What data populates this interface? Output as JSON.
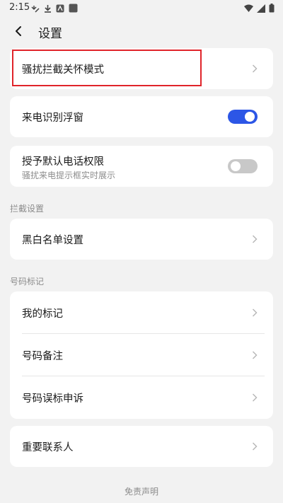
{
  "status_bar": {
    "time": "2:15",
    "icons": [
      "missed-call-icon",
      "download-icon",
      "app-a-icon",
      "app-square-icon",
      "wifi-icon",
      "signal-icon",
      "battery-icon"
    ]
  },
  "header": {
    "title": "设置"
  },
  "groups": {
    "harass_mode": {
      "label": "骚扰拦截关怀模式"
    },
    "float_window": {
      "label": "来电识别浮窗",
      "toggle_on": true
    },
    "default_phone": {
      "label": "授予默认电话权限",
      "subtitle": "骚扰来电提示框实时展示",
      "toggle_on": false
    },
    "block_section_title": "拦截设置",
    "blocklist": {
      "label": "黑白名单设置"
    },
    "mark_section_title": "号码标记",
    "my_marks": {
      "label": "我的标记"
    },
    "number_notes": {
      "label": "号码备注"
    },
    "mis_mark_appeal": {
      "label": "号码误标申诉"
    },
    "important_contacts": {
      "label": "重要联系人"
    }
  },
  "footer": {
    "disclaimer": "免责声明"
  },
  "colors": {
    "accent": "#2c56e6",
    "highlight": "#e0242a",
    "background": "#f2f2f2"
  }
}
